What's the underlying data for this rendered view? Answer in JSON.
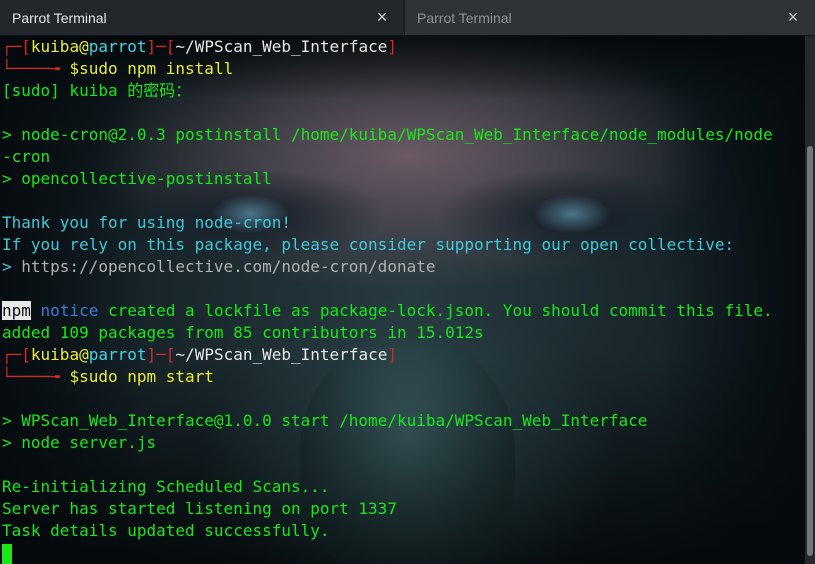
{
  "tabs": [
    {
      "title": "Parrot Terminal",
      "close": "×",
      "active": true
    },
    {
      "title": "Parrot Terminal",
      "close": "×",
      "active": false
    }
  ],
  "terminal": {
    "prompt1": {
      "corner_top": "┌─[",
      "user": "kuiba",
      "at": "@",
      "host": "parrot",
      "sep": "]─[",
      "dir": "~/WPScan_Web_Interface",
      "end": "]",
      "corner_bottom": "└────╼ ",
      "dollar": "$",
      "command": "sudo npm install"
    },
    "sudo_prompt": "[sudo] kuiba 的密码：",
    "postinstall1": "> node-cron@2.0.3 postinstall /home/kuiba/WPScan_Web_Interface/node_modules/node",
    "postinstall1b": "-cron",
    "postinstall2": "> opencollective-postinstall",
    "thanks": "Thank you for using node-cron!",
    "rely": "If you rely on this package, please consider supporting our open collective:",
    "donate_prefix": "> ",
    "donate_url": "https://opencollective.com/node-cron/donate",
    "npm_label": "npm",
    "notice_label": "notice",
    "notice_text": " created a lockfile as package-lock.json. You should commit this file.",
    "added": "added 109 packages from 85 contributors in 15.012s",
    "prompt2": {
      "corner_top": "┌─[",
      "user": "kuiba",
      "at": "@",
      "host": "parrot",
      "sep": "]─[",
      "dir": "~/WPScan_Web_Interface",
      "end": "]",
      "corner_bottom": "└────╼ ",
      "dollar": "$",
      "command": "sudo npm start"
    },
    "start1": "> WPScan_Web_Interface@1.0.0 start /home/kuiba/WPScan_Web_Interface",
    "start2": "> node server.js",
    "reinit": "Re-initializing Scheduled Scans...",
    "listening": "Server has started listening on port 1337",
    "task": "Task details updated successfully."
  },
  "colors": {
    "prompt_bracket": "#d22828",
    "user": "#ecec3a",
    "host": "#3ad8e8",
    "output": "#18e818",
    "notice": "#3c7dd8"
  }
}
